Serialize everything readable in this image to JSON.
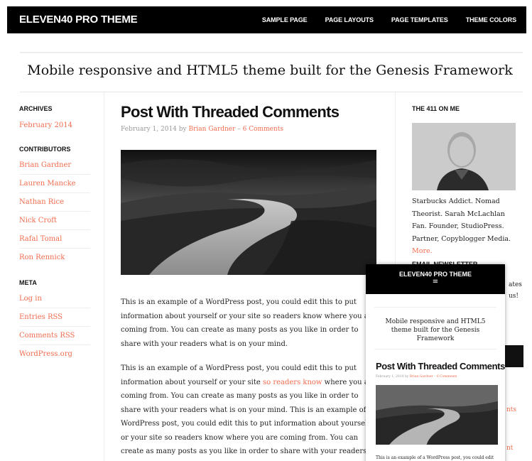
{
  "header": {
    "site_title": "ELEVEN40 PRO THEME",
    "nav": [
      "SAMPLE PAGE",
      "PAGE LAYOUTS",
      "PAGE TEMPLATES",
      "THEME COLORS"
    ]
  },
  "tagline": "Mobile responsive and HTML5 theme built for the Genesis Framework",
  "sidebar_left": {
    "archives_title": "ARCHIVES",
    "archives": [
      "February 2014"
    ],
    "contributors_title": "CONTRIBUTORS",
    "contributors": [
      "Brian Gardner",
      "Lauren Mancke",
      "Nathan Rice",
      "Nick Croft",
      "Rafal Tomal",
      "Ron Rennick"
    ],
    "meta_title": "META",
    "meta": [
      "Log in",
      "Entries RSS",
      "Comments RSS",
      "WordPress.org"
    ]
  },
  "post": {
    "title": "Post With Threaded Comments",
    "date": "February 1, 2014",
    "by": "by",
    "author": "Brian Gardner",
    "separator": "–",
    "comments": "6 Comments",
    "para1": "This is an example of a WordPress post, you could edit this to put information about yourself or your site so readers know where you are coming from. You can create as many posts as you like in order to share with your readers what is on your mind.",
    "para2_a": "This is an example of a WordPress post, you could edit this to put information about yourself or your site ",
    "para2_link": "so readers know",
    "para2_b": " where you are coming from. You can create as many posts as you like in order to share with your readers what is on your mind. This is an example of a WordPress post, you could edit this to put information about yourself or your site so readers know where you are coming from. You can create as many posts as you like in order to share with your readers what is on your mind."
  },
  "sidebar_right": {
    "about_title": "THE 411 ON ME",
    "bio": "Starbucks Addict. Nomad Theorist. Sarah McLachlan Fan. Founder, StudioPress. Partner, Copyblogger Media.",
    "more_link": "More.",
    "newsletter_title": "EMAIL NEWSLETTER",
    "peek_1": "ates",
    "peek_2": "us!",
    "peek_3": "nts",
    "peek_4": "nt"
  },
  "mobile": {
    "site_title": "ELEVEN40 PRO THEME",
    "menu_icon": "≡",
    "tagline": "Mobile responsive and HTML5 theme built for the Genesis Framework",
    "post_title": "Post With Threaded Comments",
    "date": "February 1, 2014",
    "by": "by",
    "author": "Brian Gardner",
    "separator": "–",
    "comments": "6 Comments",
    "text": "This is an example of a WordPress post, you could edit this to put information about yourself or your"
  },
  "colors": {
    "accent": "#f26c4f",
    "bar": "#000000"
  }
}
